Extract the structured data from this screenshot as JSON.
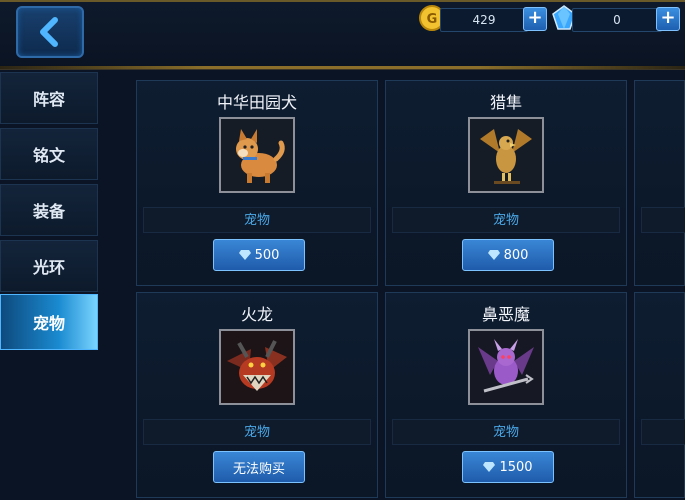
{
  "header": {
    "gold_amount": "429",
    "gem_amount": "0",
    "plus_label": "+"
  },
  "sidebar": {
    "items": [
      {
        "label": "阵容"
      },
      {
        "label": "铭文"
      },
      {
        "label": "装备"
      },
      {
        "label": "光环"
      },
      {
        "label": "宠物"
      }
    ],
    "active": "宠物"
  },
  "cards": [
    {
      "name": "中华田园犬",
      "type": "宠物",
      "price": "500",
      "price_icon": "gem-icon",
      "portrait_icon": "dog-icon"
    },
    {
      "name": "猎隼",
      "type": "宠物",
      "price": "800",
      "price_icon": "gem-icon",
      "portrait_icon": "falcon-icon"
    },
    {
      "name": "火龙",
      "type": "宠物",
      "price": "无法购买",
      "price_icon": "",
      "portrait_icon": "dragon-icon"
    },
    {
      "name": "鼻恶魔",
      "type": "宠物",
      "price": "1500",
      "price_icon": "gem-icon",
      "portrait_icon": "demon-icon"
    }
  ],
  "colors": {
    "accent": "#2f7ed0",
    "gold": "#f2c230",
    "gem": "#3aa7ff",
    "type_text": "#4ba8e8"
  }
}
